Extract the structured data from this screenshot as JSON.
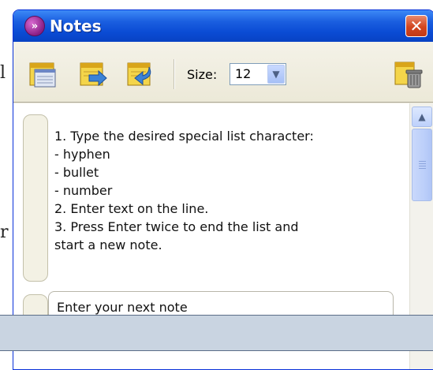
{
  "background": {
    "left_chars": [
      "l",
      "r"
    ]
  },
  "window": {
    "title": "Notes",
    "close_label": "✕",
    "app_icon_glyph": "»"
  },
  "toolbar": {
    "icons": [
      "new-note-icon",
      "import-note-icon",
      "export-note-icon",
      "delete-note-icon"
    ],
    "size_label": "Size:",
    "size_value": "12",
    "dropdown_glyph": "▼"
  },
  "note": {
    "lines": [
      "1. Type the desired special list character:",
      "- hyphen",
      "- bullet",
      "- number",
      "2. Enter text on the line.",
      "3. Press Enter twice to end the list and",
      "start a new note."
    ]
  },
  "next_note": {
    "text": "Enter your next note"
  },
  "scrollbar": {
    "up_glyph": "▲"
  },
  "colors": {
    "titlebar": "#0a4bd4",
    "close": "#d2451f",
    "overlay": "#c9d4e1"
  }
}
